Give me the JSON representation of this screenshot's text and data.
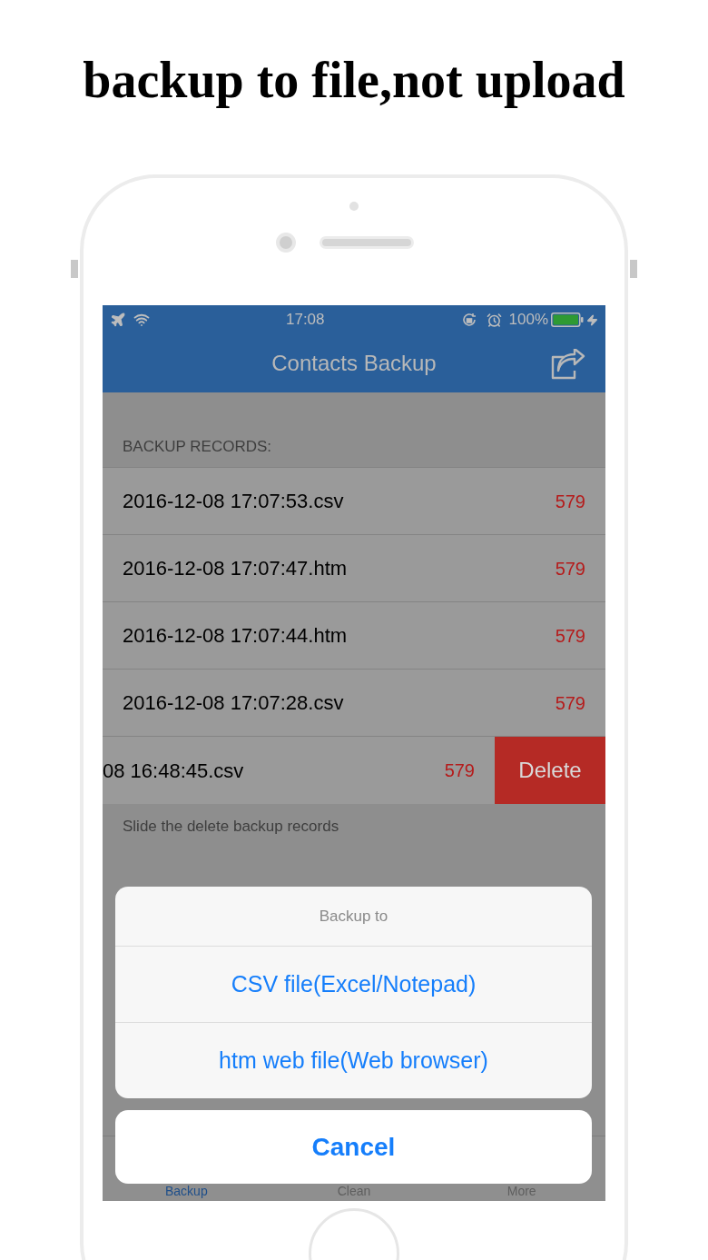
{
  "headline": "backup to file,not upload",
  "status_bar": {
    "time": "17:08",
    "battery": "100%"
  },
  "nav": {
    "title": "Contacts Backup"
  },
  "section_header": "BACKUP RECORDS:",
  "records": [
    {
      "name": "2016-12-08 17:07:53.csv",
      "count": "579",
      "swiped": false
    },
    {
      "name": "2016-12-08 17:07:47.htm",
      "count": "579",
      "swiped": false
    },
    {
      "name": "2016-12-08 17:07:44.htm",
      "count": "579",
      "swiped": false
    },
    {
      "name": "2016-12-08 17:07:28.csv",
      "count": "579",
      "swiped": false
    },
    {
      "name": "08 16:48:45.csv",
      "count": "579",
      "swiped": true,
      "action": "Delete"
    }
  ],
  "footer_note": "Slide the delete backup records",
  "tabs": [
    {
      "label": "Backup",
      "selected": true
    },
    {
      "label": "Clean",
      "selected": false
    },
    {
      "label": "More",
      "selected": false
    }
  ],
  "action_sheet": {
    "title": "Backup to",
    "options": [
      "CSV file(Excel/Notepad)",
      "htm web file(Web browser)"
    ],
    "cancel": "Cancel"
  }
}
